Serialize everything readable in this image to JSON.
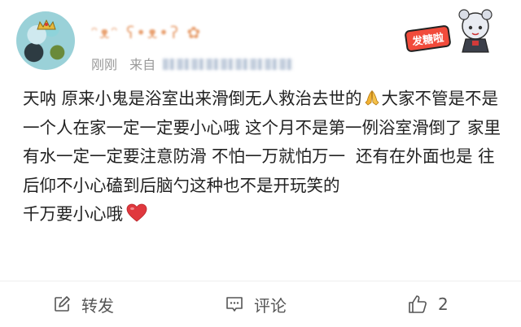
{
  "post": {
    "username": "ᵔᴥᵔ ʕ•ᴥ•ʔ ✿",
    "time": "刚刚",
    "source_label": "来自",
    "pendant_text": "发糖啦",
    "content": {
      "part1": "天呐 原来小鬼是浴室出来滑倒无人救治去世的",
      "pray_emoji": "pray-emoji",
      "part2": "大家不管是不是一个人在家一定一定要小心哦 这个月不是第一例浴室滑倒了 家里有水一定一定要注意防滑 不怕一万就怕万一  还有在外面也是 往后仰不小心磕到后脑勺这种也不是开玩笑的\n千万要小心哦",
      "heart_emoji": "red-heart-emoji"
    },
    "actions": {
      "repost_label": "转发",
      "comment_label": "评论",
      "like_count": "2"
    }
  },
  "colors": {
    "text": "#222222",
    "meta": "#999999",
    "action": "#555555",
    "heart": "#e0383e",
    "pray": "#f2b233"
  }
}
